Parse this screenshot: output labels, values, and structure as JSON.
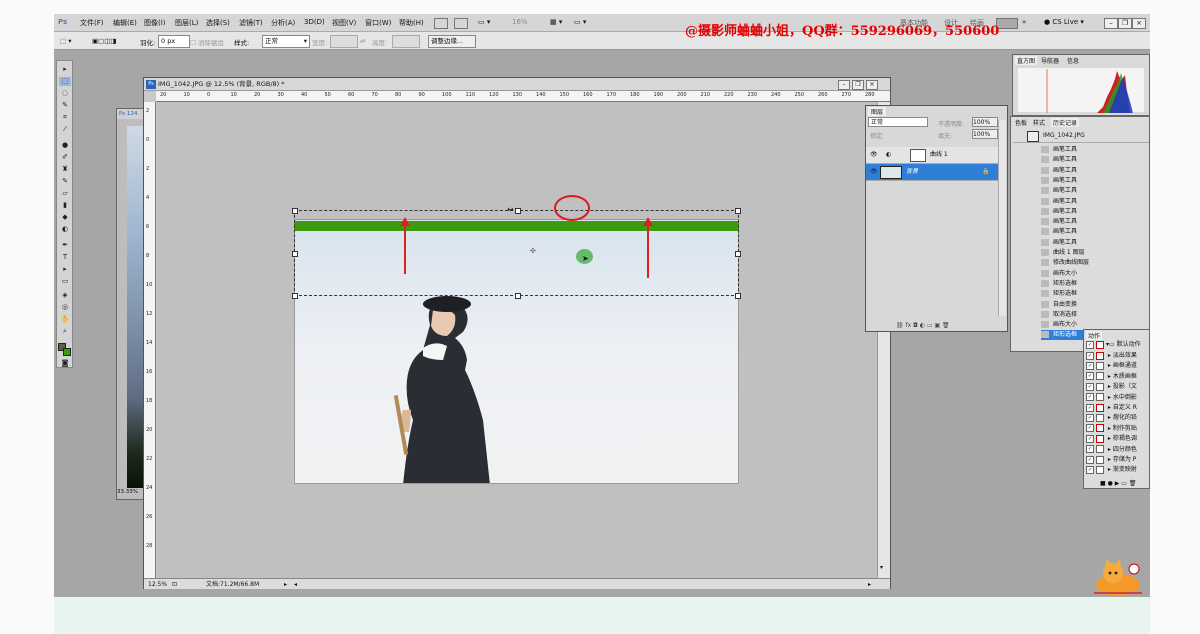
{
  "app": {
    "logo": "Ps",
    "menu": [
      "文件(F)",
      "编辑(E)",
      "图像(I)",
      "图层(L)",
      "选择(S)",
      "滤镜(T)",
      "分析(A)",
      "3D(D)",
      "视图(V)",
      "窗口(W)",
      "帮助(H)"
    ],
    "zoom_level": "16%",
    "workspace_items": [
      "基本功能",
      "设计",
      "绘画"
    ],
    "cs_live": "CS Live"
  },
  "options_bar": {
    "feather_label": "羽化:",
    "feather_value": "0 px",
    "antialias_label": "消除锯齿",
    "style_label": "样式:",
    "style_value": "正常",
    "width_label": "宽度:",
    "height_label": "高度:",
    "refine_edge_button": "调整边缘..."
  },
  "watermark": "@摄影师蛐蛐小姐，QQ群：559296069，550600",
  "document": {
    "title": "IMG_1042.JPG @ 12.5% (背景, RGB/8) *",
    "zoom": "12.5%",
    "file_info": "文档:71.2M/66.8M",
    "ruler_top": [
      "20",
      "10",
      "0",
      "10",
      "20",
      "30",
      "40",
      "50",
      "60",
      "70",
      "80",
      "90",
      "100",
      "110",
      "120",
      "130",
      "140",
      "150",
      "160",
      "170",
      "180",
      "190",
      "200",
      "210",
      "220",
      "230",
      "240",
      "250",
      "260",
      "270",
      "280"
    ],
    "ruler_left": [
      "2",
      "0",
      "2",
      "4",
      "6",
      "8",
      "10",
      "12",
      "14",
      "16",
      "18",
      "20",
      "22",
      "24",
      "26",
      "28"
    ]
  },
  "second_document": {
    "tab": "Ps 124",
    "zoom": "33.33%"
  },
  "layers_panel": {
    "tab": "图层",
    "blend_mode": "正常",
    "opacity_label": "不透明度:",
    "opacity": "100%",
    "fill_label": "填充:",
    "fill": "100%",
    "lock_label": "锁定:",
    "layers": [
      {
        "name": "曲线 1",
        "selected": false
      },
      {
        "name": "背景",
        "selected": true
      }
    ]
  },
  "histogram_panel": {
    "tabs": [
      "直方图",
      "导航器",
      "信息"
    ]
  },
  "history_panel": {
    "tabs": [
      "色板",
      "样式",
      "历史记录"
    ],
    "snapshot": "IMG_1042.JPG",
    "items": [
      "画笔工具",
      "画笔工具",
      "画笔工具",
      "画笔工具",
      "画笔工具",
      "画笔工具",
      "画笔工具",
      "画笔工具",
      "画笔工具",
      "画笔工具",
      "曲线 1 图层",
      "修改曲线图层",
      "画布大小",
      "矩形选框",
      "矩形选框",
      "自由变换",
      "取消选择",
      "画布大小",
      "矩形选框"
    ]
  },
  "actions_panel": {
    "tab": "动作",
    "set": "默认动作",
    "items": [
      "淡出效果",
      "画框通道",
      "木质画框",
      "投影（文",
      "水中倒影",
      "自定义 R",
      "熔化的铅",
      "制作剪贴",
      "棕褐色调",
      "四分颜色",
      "存储为 P",
      "渐变映射"
    ]
  },
  "colors": {
    "accent_red": "#e01818",
    "guide_green": "#3c9a0e",
    "selection_blue": "#2f7fd8",
    "watermark_red": "#e00000"
  }
}
